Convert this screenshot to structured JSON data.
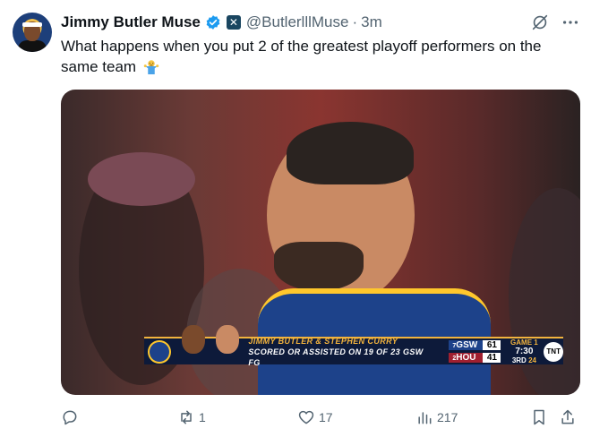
{
  "author": {
    "name": "Jimmy Butler Muse",
    "handle": "@ButlerlllMuse",
    "separator": "·",
    "time": "3m"
  },
  "tweet": {
    "text": "What happens when you put 2 of the greatest playoff performers on the same team"
  },
  "media": {
    "scorebug": {
      "line1": "JIMMY BUTLER & STEPHEN CURRY",
      "line2": "SCORED OR ASSISTED ON 19 OF 23 GSW FG",
      "teams": [
        {
          "seed": "7",
          "abbr": "GSW",
          "score": "61"
        },
        {
          "seed": "2",
          "abbr": "HOU",
          "score": "41"
        }
      ],
      "game": "GAME 1",
      "clock": "7:30",
      "period": "3RD",
      "shot_clock": "24",
      "network": "TNT"
    }
  },
  "actions": {
    "replies": "",
    "reposts": "1",
    "likes": "17",
    "views": "217"
  },
  "colors": {
    "verified": "#1d9bf0",
    "text_secondary": "#536471",
    "gsw_blue": "#1d428a",
    "gsw_gold": "#ffc72c"
  }
}
